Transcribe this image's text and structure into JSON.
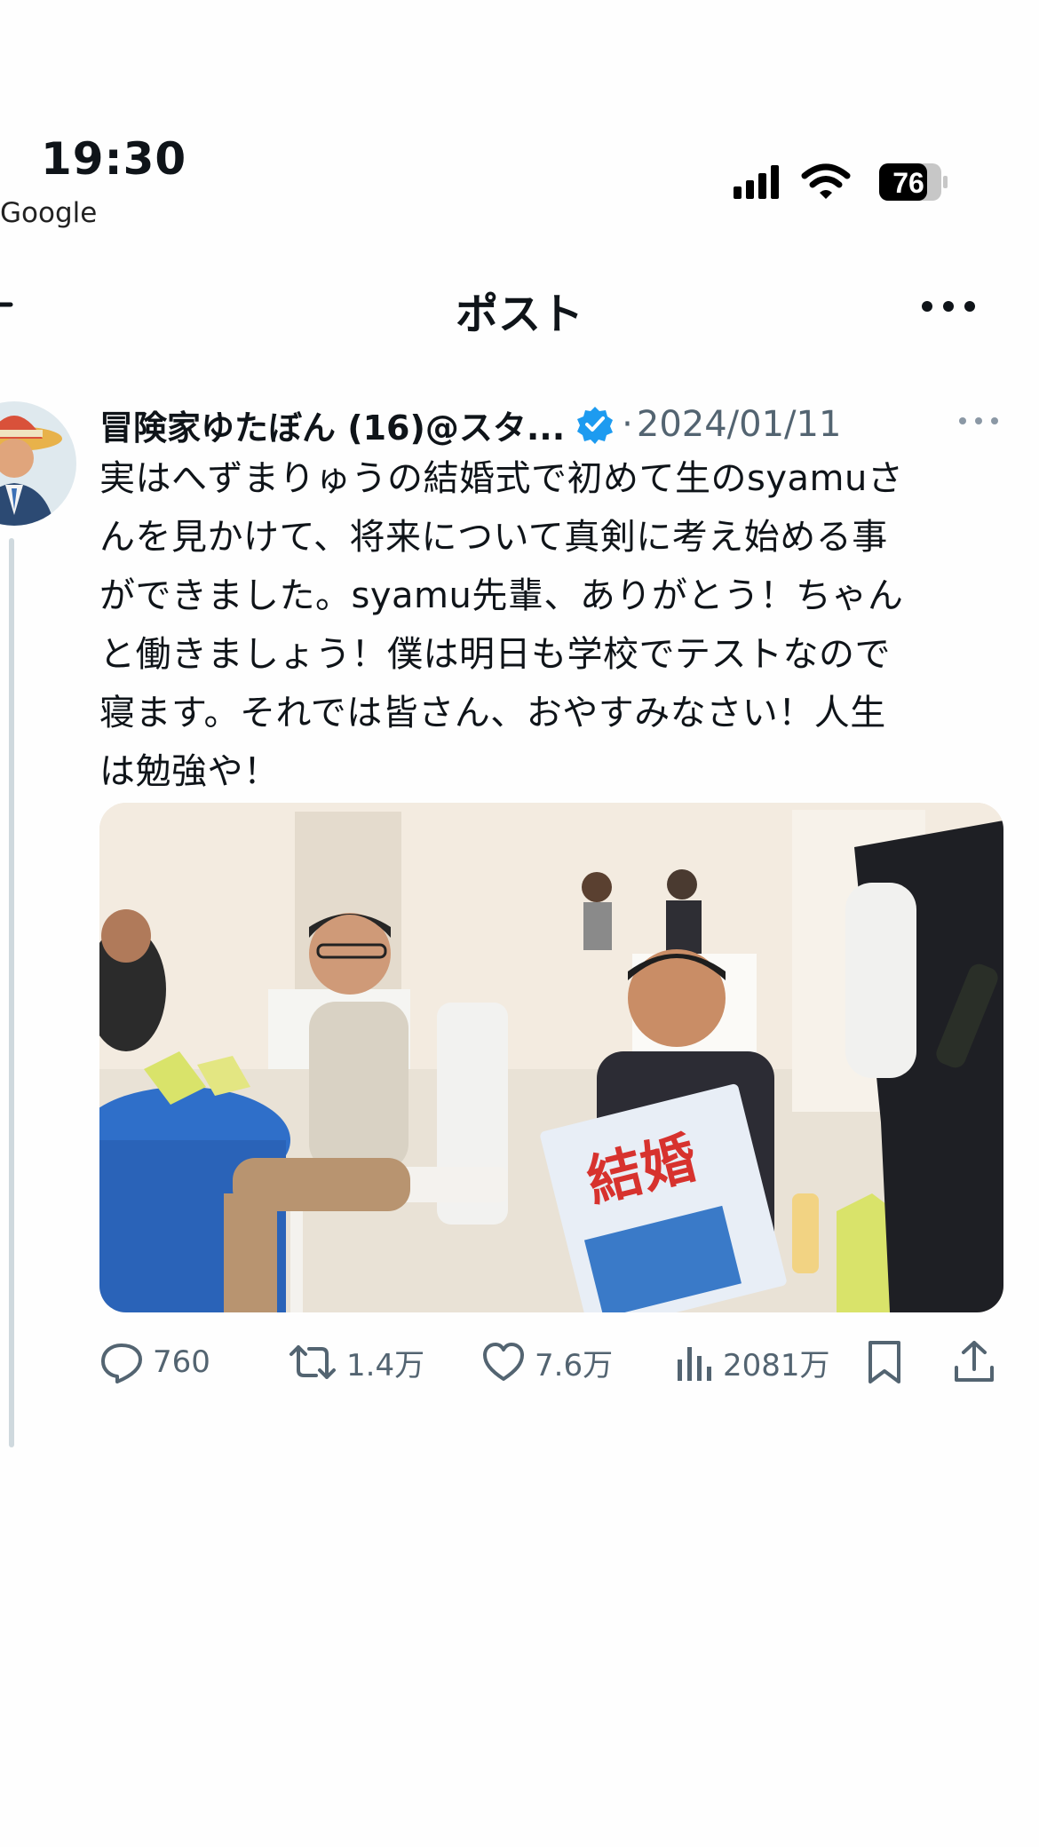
{
  "status_bar": {
    "time": "19:30",
    "carrier": "Google",
    "battery": "76"
  },
  "header": {
    "title": "ポスト"
  },
  "post": {
    "author_name": "冒険家ゆたぼん (16)@スタ...",
    "separator": "·",
    "date": "2024/01/11",
    "text_lines": [
      "実はへずまりゅうの結婚式で初めて生のsyamuさ",
      "んを見かけて、将来について真剣に考え始める事",
      "ができました。syamu先輩、ありがとう！ちゃん",
      "と働きましょう！僕は明日も学校でテストなので",
      "寝ます。それでは皆さん、おやすみなさい！人生",
      "は勉強や！"
    ],
    "photo_newspaper_headline": "結婚",
    "actions": {
      "replies": "760",
      "reposts": "1.4万",
      "likes": "7.6万",
      "views": "2081万"
    }
  },
  "colors": {
    "accent": "#1d9bf0",
    "secondary_text": "#536471",
    "thread_line": "#cfd9de"
  },
  "icons": [
    "back-arrow-icon",
    "more-icon",
    "verified-badge-icon",
    "reply-icon",
    "repost-icon",
    "like-icon",
    "views-icon",
    "bookmark-icon",
    "share-icon",
    "signal-icon",
    "wifi-icon",
    "battery-icon"
  ]
}
